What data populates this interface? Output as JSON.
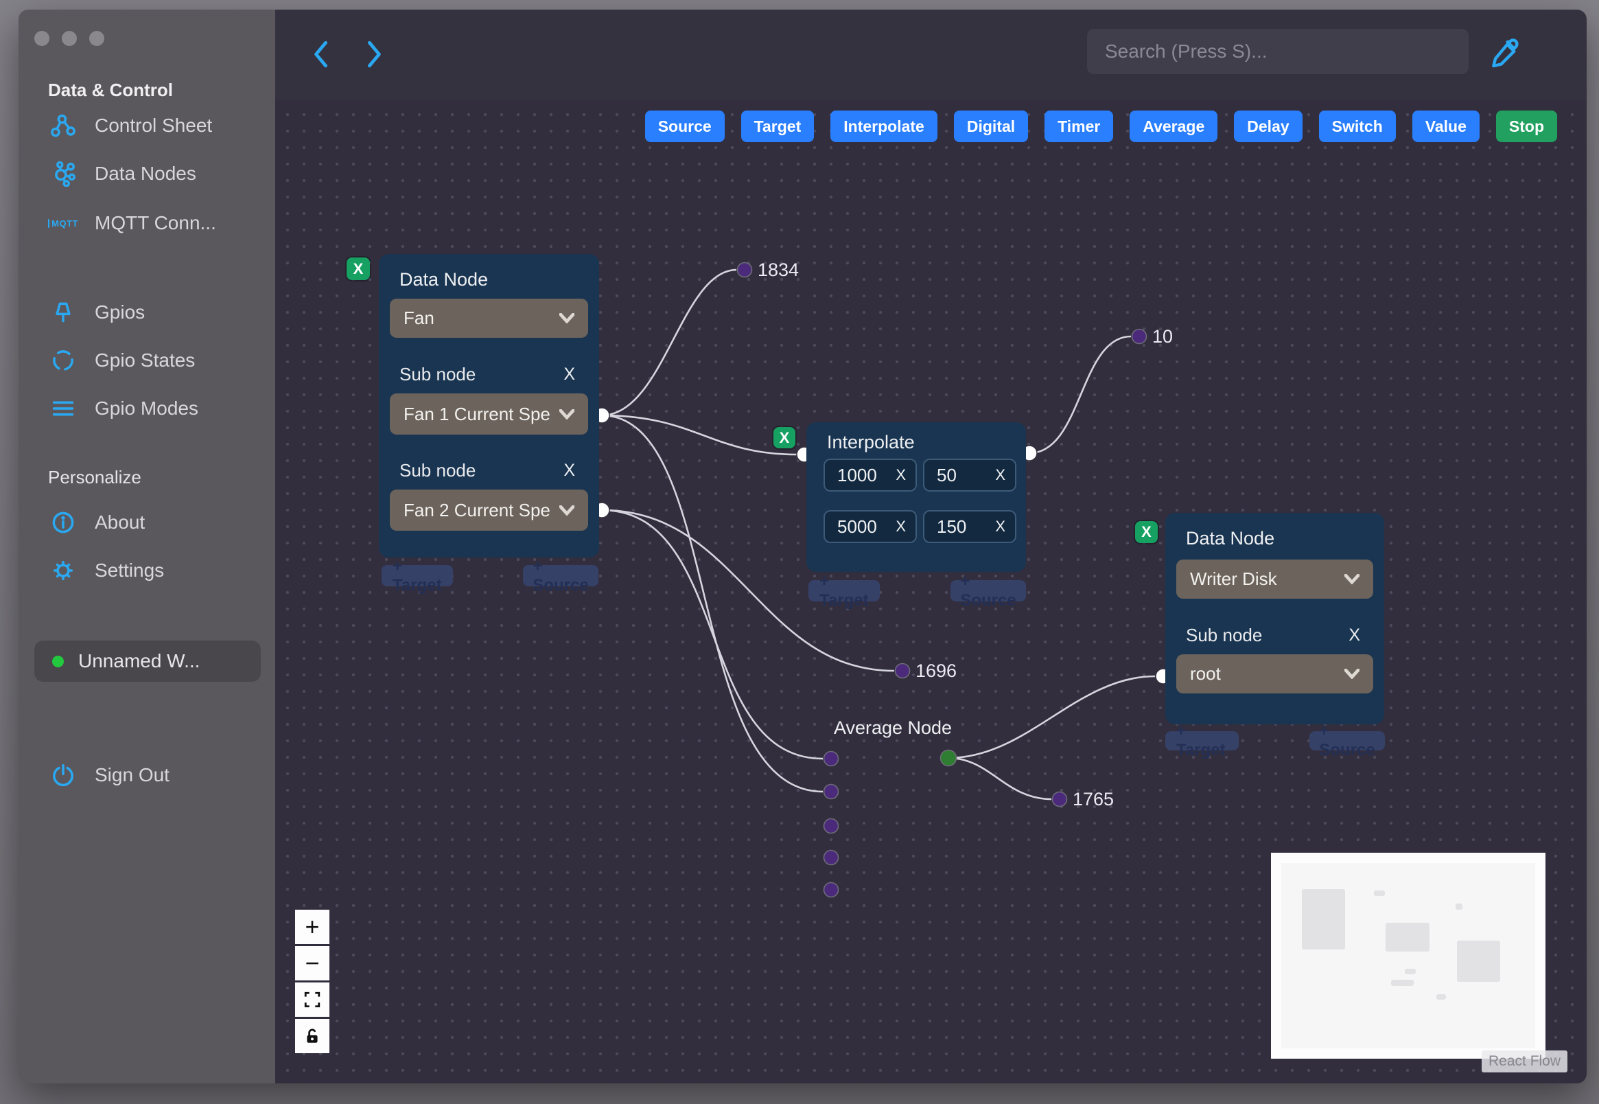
{
  "colors": {
    "accent_blue": "#2a7fff",
    "stop_green": "#21a05f",
    "delete_green": "#16a163",
    "sidebar_icon_blue": "#2aa9f2",
    "workspace_status_green": "#23c83e",
    "handle_purple": "#4b2a7b",
    "handle_green": "#2e7d32",
    "node_bg": "#1a3551"
  },
  "sidebar": {
    "header_data_control": "Data & Control",
    "mqtt_icon_text": "MQTT",
    "items": [
      {
        "label": "Control Sheet"
      },
      {
        "label": "Data Nodes"
      },
      {
        "label": "MQTT Conn..."
      },
      {
        "label": "Gpios"
      },
      {
        "label": "Gpio States"
      },
      {
        "label": "Gpio Modes"
      }
    ],
    "header_personalize": "Personalize",
    "personalize_items": [
      {
        "label": "About"
      },
      {
        "label": "Settings"
      }
    ],
    "workspace_label": "Unnamed W...",
    "sign_out_label": "Sign Out"
  },
  "topbar": {
    "search_placeholder": "Search (Press S)..."
  },
  "toolbar": {
    "buttons": [
      {
        "label": "Source"
      },
      {
        "label": "Target"
      },
      {
        "label": "Interpolate"
      },
      {
        "label": "Digital"
      },
      {
        "label": "Timer"
      },
      {
        "label": "Average"
      },
      {
        "label": "Delay"
      },
      {
        "label": "Switch"
      },
      {
        "label": "Value"
      },
      {
        "label": "Stop"
      }
    ]
  },
  "nodes": {
    "fan": {
      "delete_label": "X",
      "title": "Data Node",
      "type_value": "Fan",
      "sub1_label": "Sub node",
      "sub1_remove": "X",
      "sub1_value": "Fan 1 Current Spe",
      "sub2_label": "Sub node",
      "sub2_remove": "X",
      "sub2_value": "Fan 2 Current Spe",
      "add_target": "+ Target",
      "add_source": "+ Source"
    },
    "interpolate": {
      "delete_label": "X",
      "title": "Interpolate",
      "cells": [
        {
          "value": "1000",
          "remove": "X"
        },
        {
          "value": "50",
          "remove": "X"
        },
        {
          "value": "5000",
          "remove": "X"
        },
        {
          "value": "150",
          "remove": "X"
        }
      ],
      "add_target": "+ Target",
      "add_source": "+ Source"
    },
    "writer": {
      "delete_label": "X",
      "title": "Data Node",
      "type_value": "Writer Disk",
      "sub_label": "Sub node",
      "sub_remove": "X",
      "sub_value": "root",
      "add_target": "+ Target",
      "add_source": "+ Source"
    },
    "average": {
      "title": "Average Node"
    }
  },
  "edge_labels": {
    "top": "1834",
    "right": "10",
    "middle": "1696",
    "bottom": "1765"
  },
  "controls": {
    "zoom_in": "+",
    "zoom_out": "−"
  },
  "minimap": {
    "attribution": "React Flow"
  }
}
